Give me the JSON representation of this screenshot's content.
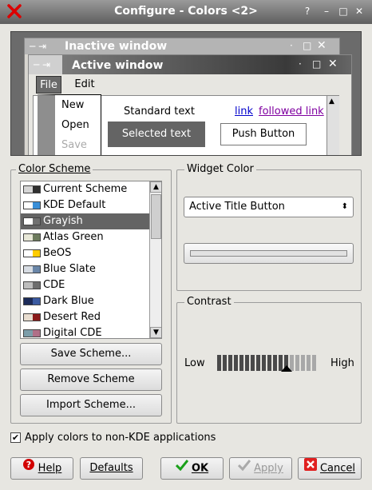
{
  "window": {
    "title": "Configure - Colors <2>",
    "controls": {
      "help": "?",
      "minimize": "–",
      "maximize": "□",
      "close": "✕"
    }
  },
  "preview": {
    "inactive_title": "Inactive window",
    "active_title": "Active window",
    "menu": {
      "file": "File",
      "edit": "Edit"
    },
    "dropdown": [
      "New",
      "Open",
      "Save"
    ],
    "standard_text": "Standard text",
    "selected_text": "Selected text",
    "link": "link",
    "followed_link": "followed link",
    "push_button": "Push Button"
  },
  "color_scheme": {
    "title": "Color Scheme",
    "selected_index": 2,
    "items": [
      {
        "label": "Current Scheme",
        "colors": [
          "#d6d6d6",
          "#303030"
        ]
      },
      {
        "label": "KDE Default",
        "colors": [
          "#ffffff",
          "#3a8fd8"
        ]
      },
      {
        "label": "Grayish",
        "colors": [
          "#ffffff",
          "#707070"
        ]
      },
      {
        "label": "Atlas Green",
        "colors": [
          "#e8e8d8",
          "#6c7a5c"
        ]
      },
      {
        "label": "BeOS",
        "colors": [
          "#ffffff",
          "#ffcc00"
        ]
      },
      {
        "label": "Blue Slate",
        "colors": [
          "#d8dde4",
          "#6a86a8"
        ]
      },
      {
        "label": "CDE",
        "colors": [
          "#bdbdbd",
          "#6e6e6e"
        ]
      },
      {
        "label": "Dark Blue",
        "colors": [
          "#1c2b5a",
          "#3b5ba2"
        ]
      },
      {
        "label": "Desert Red",
        "colors": [
          "#e8ddd0",
          "#8a1a1a"
        ]
      },
      {
        "label": "Digital CDE",
        "colors": [
          "#7c9eaa",
          "#b07088"
        ]
      }
    ],
    "save_button": "Save Scheme...",
    "remove_button": "Remove Scheme",
    "import_button": "Import Scheme..."
  },
  "widget_color": {
    "title": "Widget Color",
    "selected": "Active Title Button"
  },
  "contrast": {
    "title": "Contrast",
    "low": "Low",
    "high": "High",
    "value": 7,
    "max": 10
  },
  "apply_checkbox": {
    "label": "Apply colors to non-KDE applications",
    "checked": true
  },
  "buttons": {
    "help": "Help",
    "defaults": "Defaults",
    "ok": "OK",
    "apply": "Apply",
    "cancel": "Cancel"
  }
}
